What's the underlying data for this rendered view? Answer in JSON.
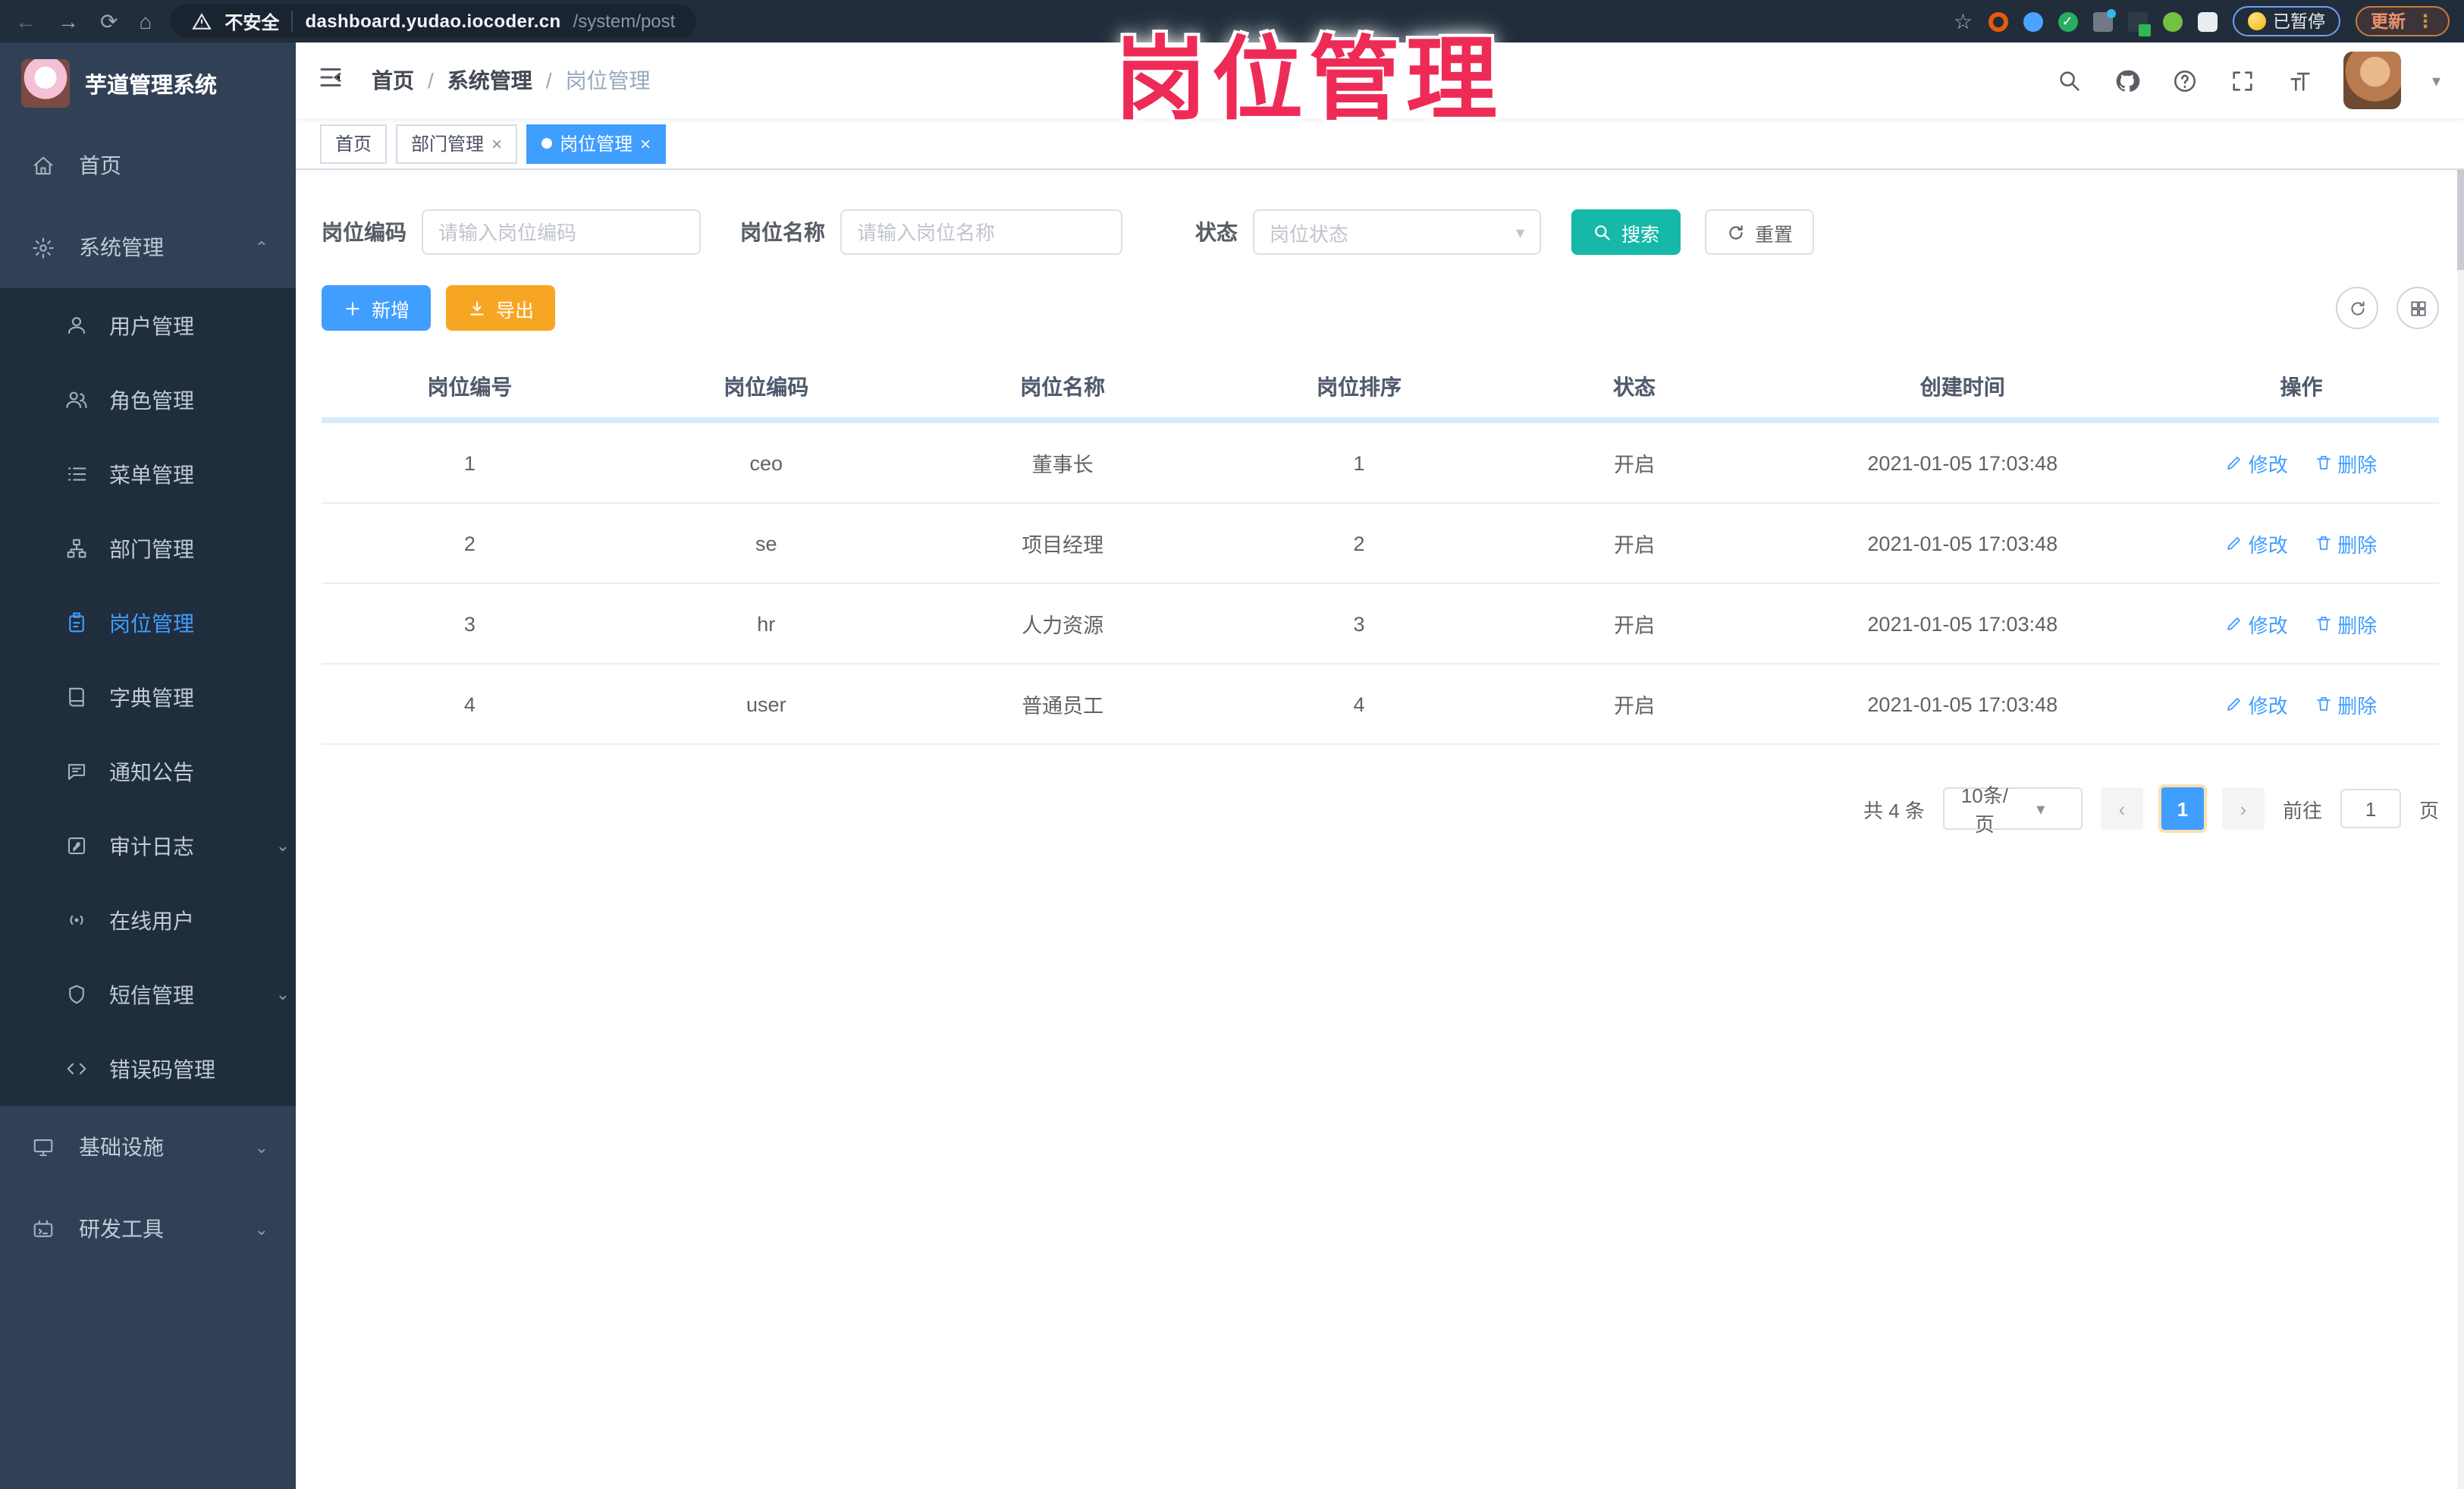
{
  "overlay": {
    "title": "岗位管理"
  },
  "browser": {
    "security_label": "不安全",
    "url_host": "dashboard.yudao.iocoder.cn",
    "url_path": "/system/post",
    "paused_label": "已暂停",
    "update_label": "更新"
  },
  "sidebar": {
    "app_title": "芋道管理系统",
    "items": [
      {
        "label": "首页",
        "icon": "home-icon"
      },
      {
        "label": "系统管理",
        "icon": "gear-icon",
        "state": "expanded"
      },
      {
        "label": "用户管理",
        "icon": "user-icon"
      },
      {
        "label": "角色管理",
        "icon": "role-icon"
      },
      {
        "label": "菜单管理",
        "icon": "menu-list-icon"
      },
      {
        "label": "部门管理",
        "icon": "dept-tree-icon"
      },
      {
        "label": "岗位管理",
        "icon": "post-badge-icon",
        "state": "active"
      },
      {
        "label": "字典管理",
        "icon": "dict-book-icon"
      },
      {
        "label": "通知公告",
        "icon": "notice-bubble-icon"
      },
      {
        "label": "审计日志",
        "icon": "audit-log-icon",
        "state": "collapsed"
      },
      {
        "label": "在线用户",
        "icon": "online-users-icon"
      },
      {
        "label": "短信管理",
        "icon": "sms-shield-icon",
        "state": "collapsed"
      },
      {
        "label": "错误码管理",
        "icon": "error-code-icon"
      },
      {
        "label": "基础设施",
        "icon": "infra-icon",
        "state": "collapsed"
      },
      {
        "label": "研发工具",
        "icon": "devtools-icon",
        "state": "collapsed"
      }
    ]
  },
  "navbar": {
    "breadcrumbs": [
      "首页",
      "系统管理",
      "岗位管理"
    ]
  },
  "tags": [
    {
      "label": "首页",
      "closable": false,
      "active": false
    },
    {
      "label": "部门管理",
      "closable": true,
      "active": false
    },
    {
      "label": "岗位管理",
      "closable": true,
      "active": true
    }
  ],
  "filters": {
    "code_label": "岗位编码",
    "code_placeholder": "请输入岗位编码",
    "name_label": "岗位名称",
    "name_placeholder": "请输入岗位名称",
    "status_label": "状态",
    "status_placeholder": "岗位状态",
    "search_label": "搜索",
    "reset_label": "重置"
  },
  "toolbar": {
    "add_label": "新增",
    "export_label": "导出"
  },
  "table": {
    "headers": [
      "岗位编号",
      "岗位编码",
      "岗位名称",
      "岗位排序",
      "状态",
      "创建时间",
      "操作"
    ],
    "edit_label": "修改",
    "delete_label": "删除",
    "rows": [
      {
        "id": "1",
        "code": "ceo",
        "name": "董事长",
        "sort": "1",
        "status": "开启",
        "created": "2021-01-05 17:03:48"
      },
      {
        "id": "2",
        "code": "se",
        "name": "项目经理",
        "sort": "2",
        "status": "开启",
        "created": "2021-01-05 17:03:48"
      },
      {
        "id": "3",
        "code": "hr",
        "name": "人力资源",
        "sort": "3",
        "status": "开启",
        "created": "2021-01-05 17:03:48"
      },
      {
        "id": "4",
        "code": "user",
        "name": "普通员工",
        "sort": "4",
        "status": "开启",
        "created": "2021-01-05 17:03:48"
      }
    ]
  },
  "pagination": {
    "total": "共 4 条",
    "page_size": "10条/页",
    "page": "1",
    "goto_label": "前往",
    "goto_value": "1",
    "page_unit": "页"
  },
  "colors": {
    "accent": "#409eff",
    "search_teal": "#16b8a8",
    "export_orange": "#f6a623",
    "overlay_pink": "#ee2b57",
    "sidebar_bg": "#304156",
    "submenu_bg": "#1f2d3d"
  }
}
